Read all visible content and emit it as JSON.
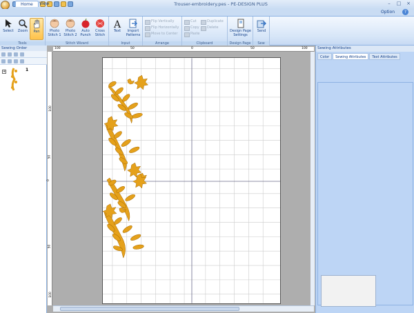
{
  "window": {
    "title": "Trouser-embroidery.pes - PE-DESIGN PLUS",
    "option_label": "Option",
    "help_label": "?",
    "controls": {
      "minimize": "–",
      "maximize": "□",
      "close": "×"
    }
  },
  "tabs": [
    {
      "label": "Home"
    },
    {
      "label": "View"
    }
  ],
  "ribbon": {
    "groups": [
      {
        "label": "Tools"
      },
      {
        "label": "Stitch Wizard"
      },
      {
        "label": "Input"
      },
      {
        "label": "Arrange"
      },
      {
        "label": "Clipboard"
      },
      {
        "label": "Design Page"
      },
      {
        "label": "Sew"
      }
    ],
    "tools": {
      "select": "Select",
      "zoom": "Zoom",
      "pan": "Pan"
    },
    "wizard": {
      "photo1": "Photo Stitch 1",
      "photo2": "Photo Stitch 2",
      "auto_punch": "Auto Punch",
      "cross_stitch": "Cross Stitch"
    },
    "input": {
      "text": "Text",
      "import": "Import Patterns"
    },
    "arrange": {
      "flip_v": "Flip Vertically",
      "flip_h": "Flip Horizontally",
      "move_center": "Move to Center"
    },
    "clipboard": {
      "cut": "Cut",
      "copy": "Copy",
      "paste": "Paste",
      "duplicate": "Duplicate",
      "delete": "Delete"
    },
    "design_page": {
      "settings": "Design Page Settings"
    },
    "sew": {
      "send": "Send"
    }
  },
  "sewing_order": {
    "title": "Sewing Order",
    "item_number": "1"
  },
  "rulers": {
    "top": [
      "100",
      "50",
      "0",
      "50",
      "100"
    ],
    "left": [
      "100",
      "50",
      "0",
      "50",
      "100"
    ]
  },
  "sewing_attributes": {
    "title": "Sewing Attributes",
    "tabs": [
      {
        "label": "Color"
      },
      {
        "label": "Sewing Attributes"
      },
      {
        "label": "Text Attributes"
      }
    ]
  },
  "colors": {
    "embroidery": "#e5a11b",
    "embroidery_dark": "#a76b05",
    "grid": "#c9c9c9",
    "axis": "#6a6a8a"
  }
}
